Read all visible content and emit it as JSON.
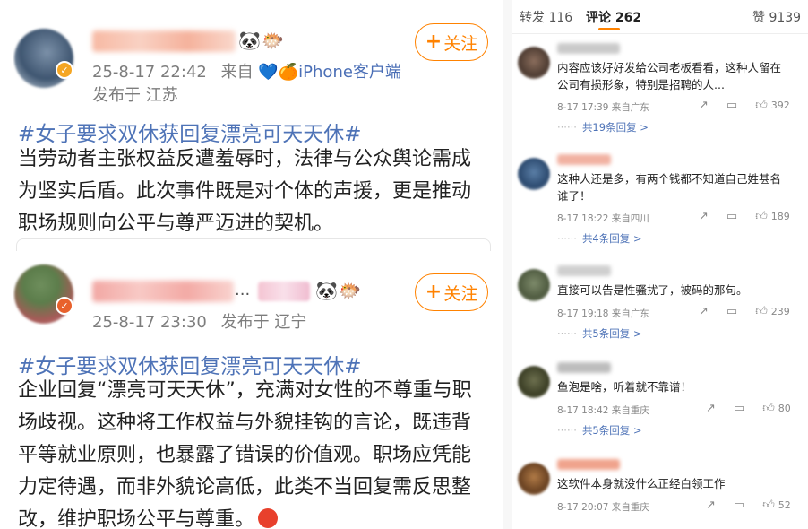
{
  "posts": [
    {
      "timestamp": "25-8-17 22:42",
      "source_prefix": "来自",
      "source": "iPhone客户端",
      "location": "发布于 江苏",
      "follow_label": "关注",
      "topic": "#女子要求双休获回复漂亮可天天休#",
      "body": "当劳动者主张权益反遭羞辱时，法律与公众舆论需成为坚实后盾。此次事件既是对个体的声援，更是推动职场规则向公平与尊严迈进的契机。"
    },
    {
      "timestamp": "25-8-17 23:30",
      "location": "发布于 辽宁",
      "follow_label": "关注",
      "name_suffix": "...",
      "topic": "#女子要求双休获回复漂亮可天天休#",
      "body": "企业回复“漂亮可天天休”，充满对女性的不尊重与职场歧视。这种将工作权益与外貌挂钩的言论，既违背平等就业原则，也暴露了错误的价值观。职场应凭能力定待遇，而非外貌论高低，此类不当回复需反思整改，维护职场公平与尊重。"
    }
  ],
  "tabs": {
    "repost_label": "转发",
    "repost_count": "116",
    "comment_label": "评论",
    "comment_count": "262",
    "like_label": "赞",
    "like_count": "9139"
  },
  "comments": [
    {
      "text": "内容应该好好发给公司老板看看，这种人留在公司有损形象，特别是招聘的人...",
      "time": "8-17 17:39",
      "location": "来自广东",
      "likes": "392",
      "replies": "共19条回复 >"
    },
    {
      "text": "这种人还是多，有两个钱都不知道自己姓甚名谁了！",
      "time": "8-17 18:22",
      "location": "来自四川",
      "likes": "189",
      "replies": "共4条回复 >"
    },
    {
      "text": "直接可以告是性骚扰了，被码的那句。",
      "time": "8-17 19:18",
      "location": "来自广东",
      "likes": "239",
      "replies": "共5条回复 >"
    },
    {
      "text": "鱼泡是啥，听着就不靠谱！",
      "time": "8-17 18:42",
      "location": "来自重庆",
      "likes": "80",
      "replies": "共5条回复 >"
    },
    {
      "text": "这软件本身就没什么正经白领工作",
      "time": "8-17 20:07",
      "location": "来自重庆",
      "likes": "52"
    }
  ],
  "icons": {
    "share": "share-icon",
    "comment": "comment-icon",
    "like": "thumb-up-icon"
  },
  "colors": {
    "accent": "#ff8200",
    "topic_blue": "#4e73b7",
    "meta_gray": "#7d7d7d"
  }
}
